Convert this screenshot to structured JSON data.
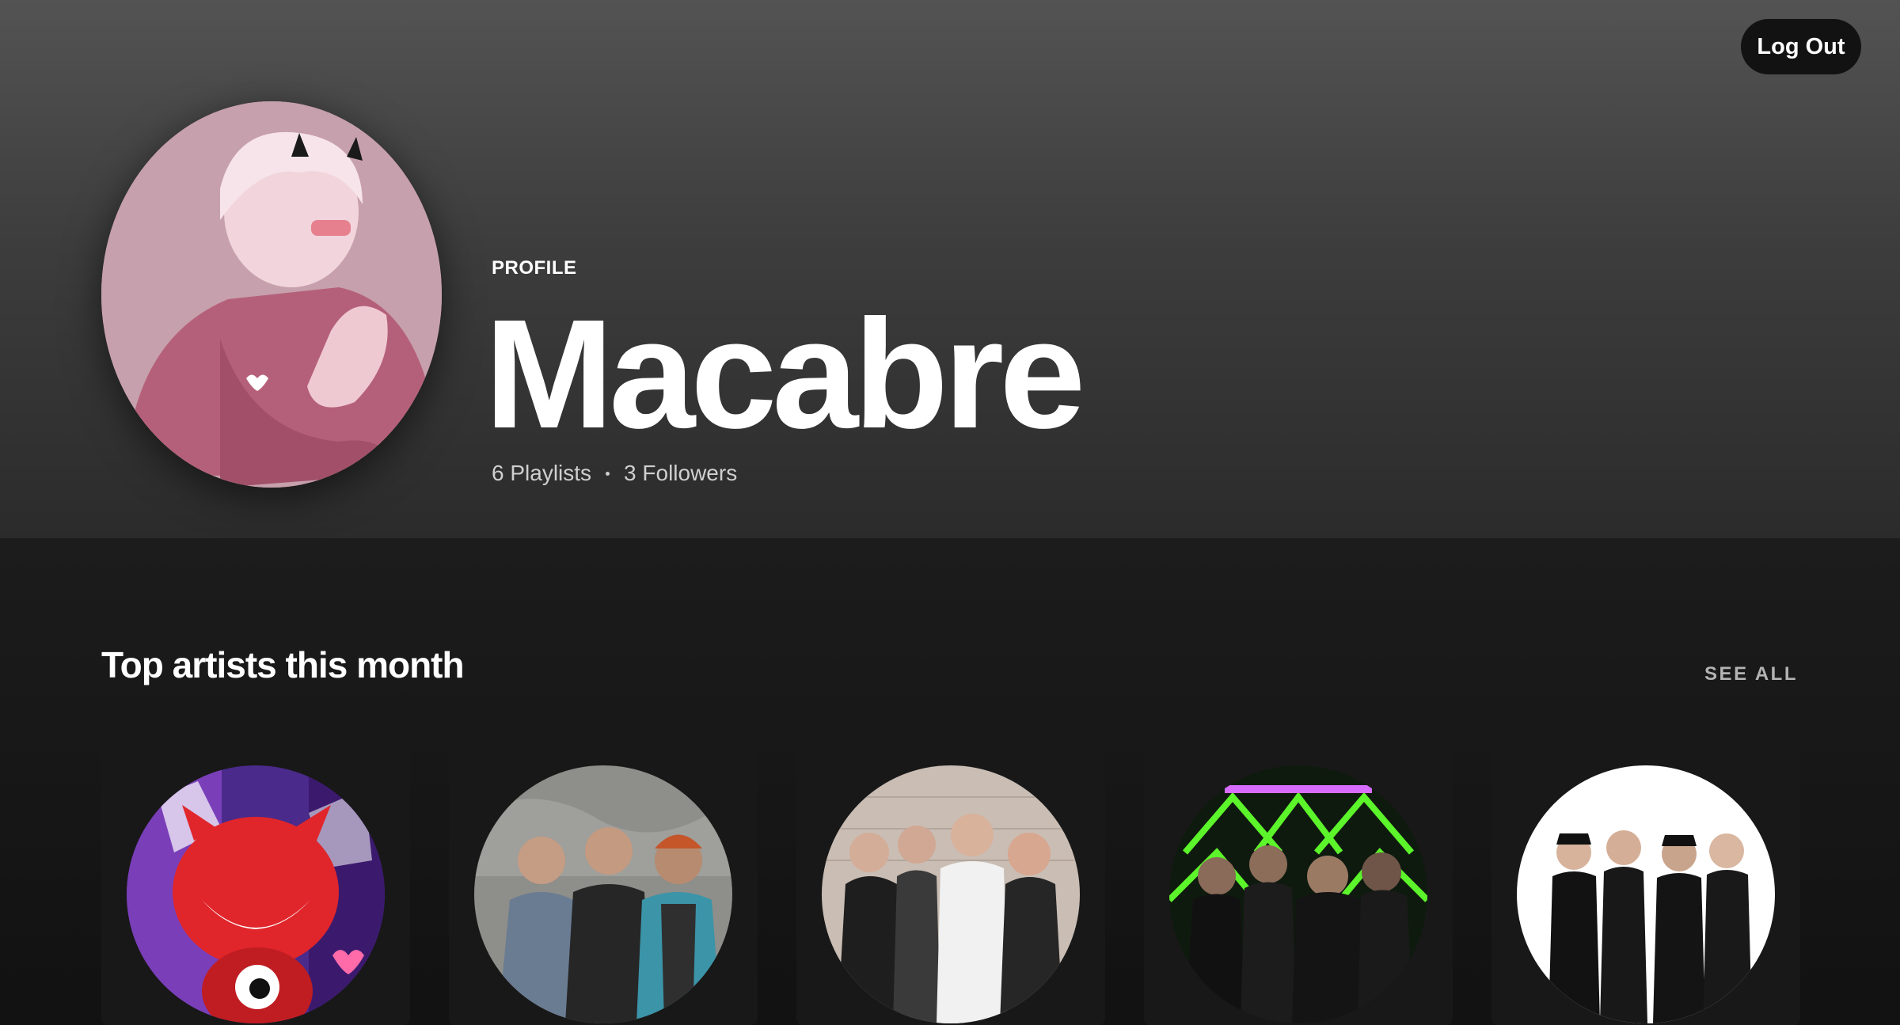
{
  "header": {
    "logout_label": "Log Out"
  },
  "profile": {
    "type_label": "PROFILE",
    "name": "Macabre",
    "playlists": "6 Playlists",
    "followers": "3 Followers",
    "avatar_icon": "profile-avatar-image"
  },
  "top_artists": {
    "title": "Top artists this month",
    "see_all_label": "SEE ALL",
    "artists": [
      {
        "image_icon": "artist-image"
      },
      {
        "image_icon": "artist-image"
      },
      {
        "image_icon": "artist-image"
      },
      {
        "image_icon": "artist-image"
      },
      {
        "image_icon": "artist-image"
      }
    ]
  },
  "colors": {
    "background": "#121212",
    "hero_top": "#535353",
    "card": "#181818",
    "muted_text": "#b3b3b3"
  }
}
